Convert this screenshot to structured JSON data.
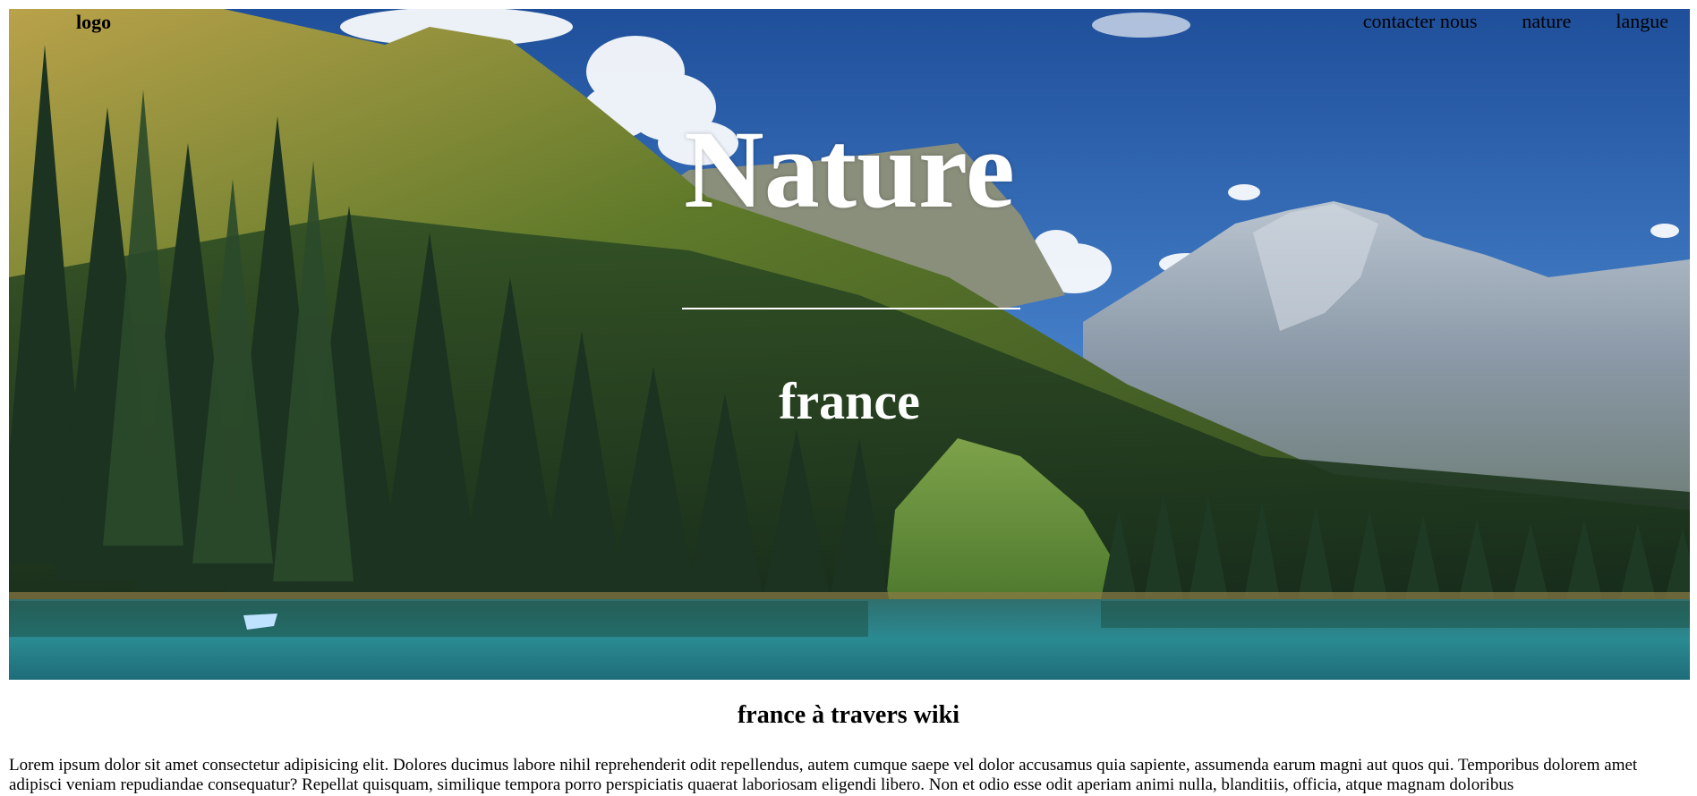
{
  "header": {
    "logo": "logo",
    "nav": [
      "contacter nous",
      "nature",
      "langue"
    ]
  },
  "hero": {
    "title": "Nature",
    "subtitle": "france",
    "image": "mountain-lake-forest-photo"
  },
  "content": {
    "heading": "france à travers wiki",
    "paragraph": "Lorem ipsum dolor sit amet consectetur adipisicing elit. Dolores ducimus labore nihil reprehenderit odit repellendus, autem cumque saepe vel dolor accusamus quia sapiente, assumenda earum magni aut quos qui. Temporibus dolorem amet adipisci veniam repudiandae consequatur? Repellat quisquam, similique tempora porro perspiciatis quaerat laboriosam eligendi libero. Non et odio esse odit aperiam animi nulla, blanditiis, officia, atque magnam doloribus"
  }
}
